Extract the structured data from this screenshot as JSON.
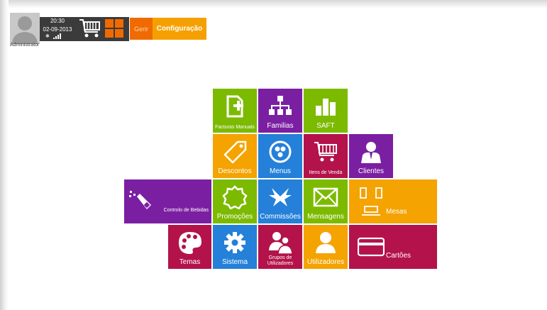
{
  "header": {
    "time": "20:30",
    "date": "02-09-2013",
    "user": "Administrator",
    "tab_gerir": "Gerir",
    "tab_configuracao": "Configuração"
  },
  "tiles": {
    "facturas": "Facturas Manuais",
    "familias": "Familias",
    "saft": "SAFT",
    "descontos": "Descontos",
    "menus": "Menus",
    "itens_venda": "Itens de Venda",
    "clientes": "Clientes",
    "controlo_bebidas": "Controlo de Bebidas",
    "promocoes": "Promoções",
    "comissoes": "Commissões",
    "mensagens": "Mensagens",
    "mesas": "Mesas",
    "temas": "Temas",
    "sistema": "Sistema",
    "grupos_utilizadores": "Grupos de Utilizadores",
    "utilizadores": "Utilizadores",
    "cartoes": "Cartões"
  },
  "colors": {
    "green": "#7cba00",
    "purple": "#7b1fa2",
    "orange": "#f4a300",
    "blue": "#2480d8",
    "crimson": "#b3134a",
    "tab_gerir": "#f06a00",
    "tab_config": "#f5a000"
  },
  "icons": [
    "user-avatar-icon",
    "shopping-cart-icon",
    "grid-icon",
    "gear-icon",
    "signal-icon",
    "document-plus-icon",
    "hierarchy-icon",
    "bar-chart-icon",
    "tag-icon",
    "menu-circle-icon",
    "cart-icon",
    "client-icon",
    "bottle-icon",
    "badge-icon",
    "bird-icon",
    "envelope-icon",
    "table-chairs-icon",
    "palette-icon",
    "cog-icon",
    "users-group-icon",
    "user-icon",
    "card-icon"
  ]
}
